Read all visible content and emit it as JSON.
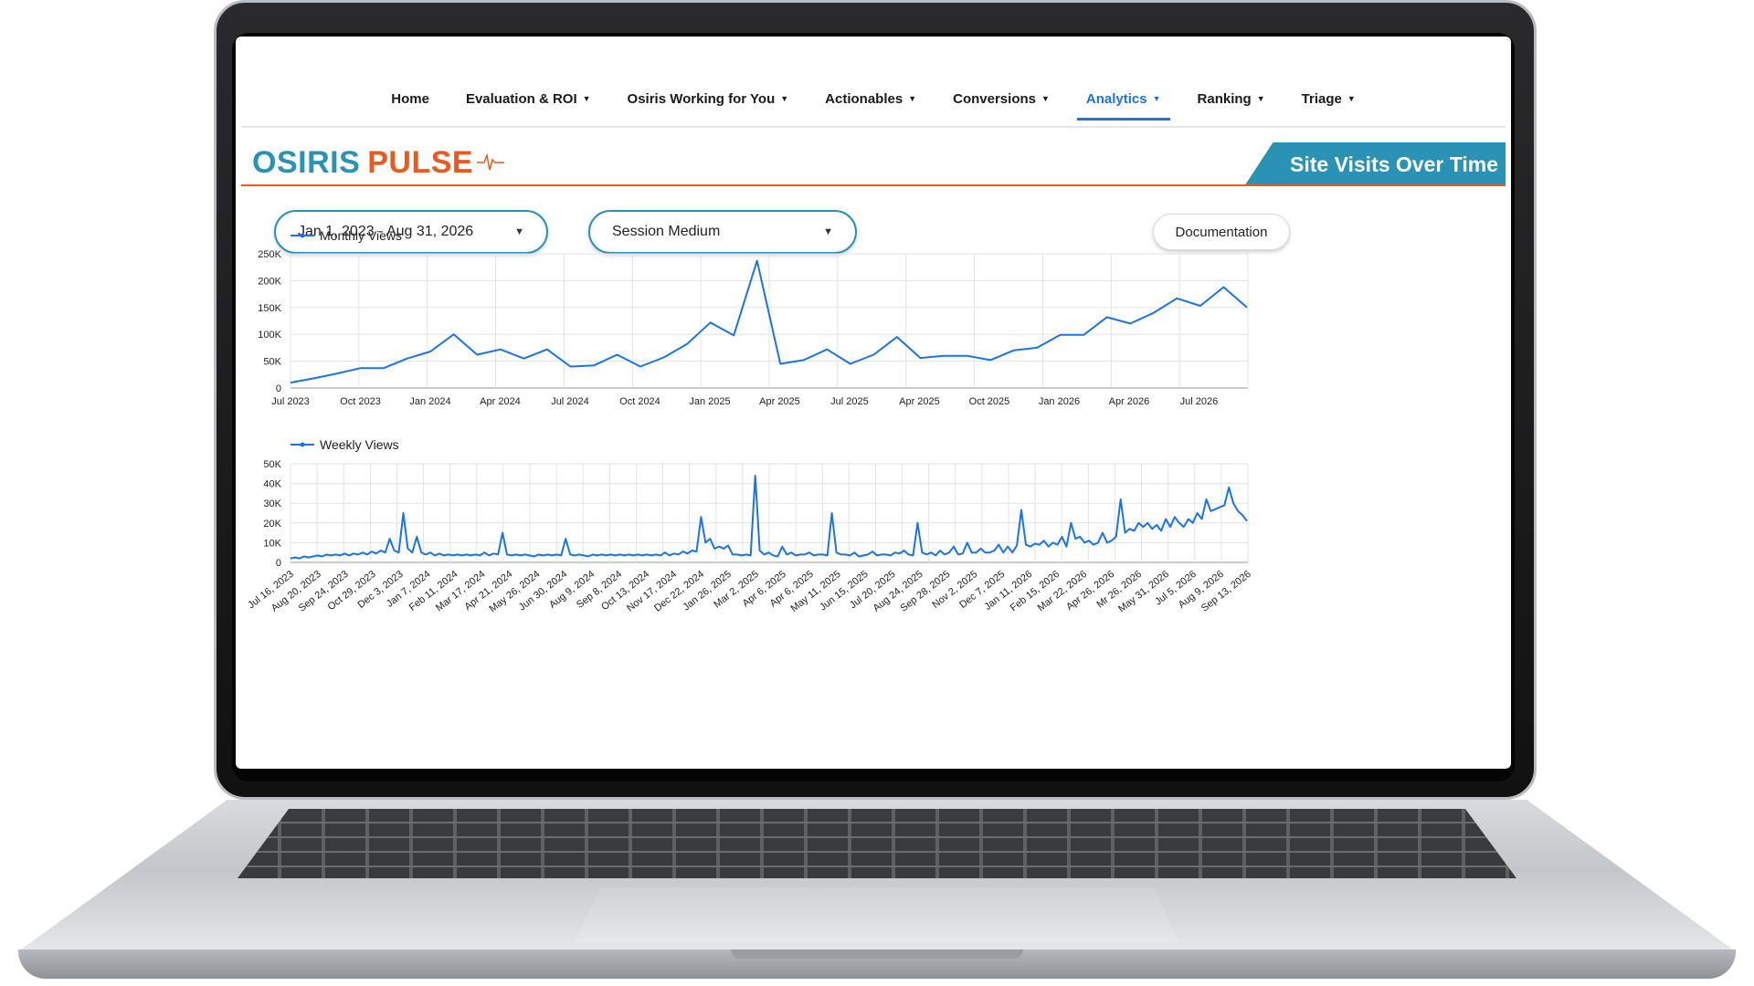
{
  "nav": {
    "items": [
      {
        "label": "Home",
        "dropdown": false,
        "active": false
      },
      {
        "label": "Evaluation & ROI",
        "dropdown": true,
        "active": false
      },
      {
        "label": "Osiris Working for You",
        "dropdown": true,
        "active": false
      },
      {
        "label": "Actionables",
        "dropdown": true,
        "active": false
      },
      {
        "label": "Conversions",
        "dropdown": true,
        "active": false
      },
      {
        "label": "Analytics",
        "dropdown": true,
        "active": true
      },
      {
        "label": "Ranking",
        "dropdown": true,
        "active": false
      },
      {
        "label": "Triage",
        "dropdown": true,
        "active": false
      }
    ]
  },
  "brand": {
    "logo_part1": "OSIRIS",
    "logo_part2": "PULSE",
    "colors": {
      "primary": "#2a93b5",
      "accent": "#ea5a1f",
      "active_nav": "#1a73e8"
    }
  },
  "banner": {
    "title": "Site Visits Over Time"
  },
  "filters": {
    "date_range": "Jan 1, 2023 - Aug 31, 2026",
    "session_medium": "Session Medium",
    "documentation_label": "Documentation"
  },
  "chart_data": [
    {
      "type": "line",
      "series": [
        {
          "name": "Monthly Views",
          "color": "#1a73e8",
          "values": [
            10000,
            18000,
            27000,
            37000,
            37000,
            55000,
            68000,
            100000,
            62000,
            72000,
            55000,
            72000,
            40000,
            42000,
            62000,
            40000,
            57000,
            82000,
            122000,
            98000,
            237000,
            45000,
            52000,
            72000,
            45000,
            62000,
            95000,
            56000,
            60000,
            60000,
            52000,
            70000,
            75000,
            99000,
            99000,
            132000,
            120000,
            140000,
            167000,
            153000,
            188000,
            150000
          ]
        }
      ],
      "x": [
        "Jul 2023",
        "Aug 2023",
        "Sep 2023",
        "Oct 2023",
        "Nov 2023",
        "Dec 2023",
        "Jan 2024",
        "Feb 2024",
        "Mar 2024",
        "Apr 2024",
        "May 2024",
        "Jun 2024",
        "Jul 2024",
        "Aug 2024",
        "Sep 2024",
        "Oct 2024",
        "Nov 2024",
        "Dec 2024",
        "Jan 2025",
        "Feb 2025",
        "Mar 2025",
        "Apr 2025",
        "May 2025",
        "Jun 2025",
        "Jul 2025",
        "Aug 2025",
        "Sep 2025",
        "Oct 2025",
        "Nov 2025",
        "Dec 2025",
        "Jan 2026",
        "Feb 2026",
        "Mar 2026",
        "Apr 2026",
        "May 2026",
        "Jun 2026",
        "Jul 2026",
        "Aug 2026",
        "Sep 2026",
        "Oct 2026",
        "Nov 2026",
        "Dec 2026"
      ],
      "x_tick_labels": [
        "Jul 2023",
        "Oct 2023",
        "Jan 2024",
        "Apr 2024",
        "Jul 2024",
        "Oct 2024",
        "Jan 2025",
        "Apr 2025",
        "Jul 2025",
        "Apr 2025",
        "Oct 2025",
        "Jan 2026",
        "Apr 2026",
        "Jul 2026"
      ],
      "y_tick_labels": [
        "0",
        "50K",
        "100K",
        "150K",
        "200K",
        "250K"
      ],
      "ylim": [
        0,
        250000
      ],
      "grid": true,
      "legend": "top-left"
    },
    {
      "type": "line",
      "series": [
        {
          "name": "Weekly Views",
          "color": "#1a73e8",
          "values": [
            2000,
            2500,
            2000,
            3000,
            2500,
            3000,
            3500,
            3000,
            4000,
            3500,
            4000,
            3500,
            4500,
            3500,
            4500,
            4000,
            5000,
            4000,
            5500,
            4500,
            6000,
            5000,
            12000,
            6000,
            5000,
            25000,
            7000,
            5000,
            13000,
            5000,
            4000,
            5000,
            3500,
            4500,
            3500,
            4000,
            3500,
            4000,
            3500,
            4000,
            3500,
            4000,
            3500,
            5000,
            3500,
            4500,
            4000,
            15000,
            4000,
            3500,
            4000,
            3500,
            4000,
            3500,
            3000,
            4000,
            3500,
            4000,
            3500,
            4000,
            3500,
            12000,
            4000,
            3500,
            4000,
            3500,
            3000,
            4000,
            3500,
            4000,
            3500,
            4000,
            3500,
            4000,
            3500,
            4000,
            3500,
            4000,
            3500,
            4000,
            3500,
            4000,
            3500,
            5000,
            3500,
            4500,
            4000,
            5500,
            4500,
            6000,
            5500,
            23000,
            10000,
            12000,
            7000,
            8000,
            7000,
            8500,
            4000,
            4000,
            3500,
            4000,
            3500,
            44000,
            6000,
            4000,
            5000,
            3500,
            3000,
            8000,
            4000,
            5000,
            3500,
            4000,
            4000,
            5000,
            3500,
            4000,
            4000,
            3500,
            25000,
            5000,
            4000,
            4000,
            3500,
            5000,
            3000,
            3500,
            4000,
            5500,
            3500,
            4000,
            4000,
            3500,
            5000,
            4500,
            6000,
            4000,
            3500,
            20000,
            5000,
            4000,
            5000,
            3500,
            6000,
            4000,
            5000,
            8000,
            4000,
            4500,
            10000,
            5000,
            5000,
            7000,
            5000,
            5000,
            6000,
            9000,
            5000,
            8000,
            5000,
            8500,
            26500,
            9000,
            8000,
            9500,
            9000,
            11000,
            8000,
            10000,
            9000,
            13000,
            8000,
            20000,
            12000,
            13000,
            10000,
            11000,
            9000,
            10000,
            15000,
            10000,
            11000,
            13000,
            32000,
            15000,
            17000,
            16000,
            20000,
            18000,
            20000,
            17000,
            19000,
            16000,
            22000,
            18000,
            23000,
            20000,
            18000,
            22000,
            20000,
            25000,
            22000,
            32000,
            26000,
            27000,
            28000,
            29000,
            38000,
            30000,
            26000,
            24000,
            21000
          ]
        }
      ],
      "x_tick_labels": [
        "Jul 16, 2023",
        "Aug 20, 2023",
        "Sep 24, 2023",
        "Oct 29, 2023",
        "Dec 3, 2023",
        "Jan 7, 2024",
        "Feb 11, 2024",
        "Mar 17, 2024",
        "Apr 21, 2024",
        "May 26, 2024",
        "Jun 30, 2024",
        "Aug 9, 2024",
        "Sep 8, 2024",
        "Oct 13, 2024",
        "Nov 17, 2024",
        "Dec 22, 2024",
        "Jan 26, 2025",
        "Mar 2, 2025",
        "Apr 6, 2025",
        "Apr 6, 2025",
        "May 11, 2025",
        "Jun 15, 2025",
        "Jul 20, 2025",
        "Aug 24, 2025",
        "Sep 28, 2025",
        "Nov 2, 2025",
        "Dec 7, 2025",
        "Jan 11, 2026",
        "Feb 15, 2026",
        "Mar 22, 2026",
        "Apr 26, 2026",
        "Mr 26, 2026",
        "May 31, 2026",
        "Jul 5, 2026",
        "Aug 9, 2026",
        "Sep 13, 2026"
      ],
      "y_tick_labels": [
        "0",
        "10K",
        "20K",
        "30K",
        "40K",
        "50K"
      ],
      "ylim": [
        0,
        50000
      ],
      "grid": true,
      "legend": "top-left"
    }
  ]
}
